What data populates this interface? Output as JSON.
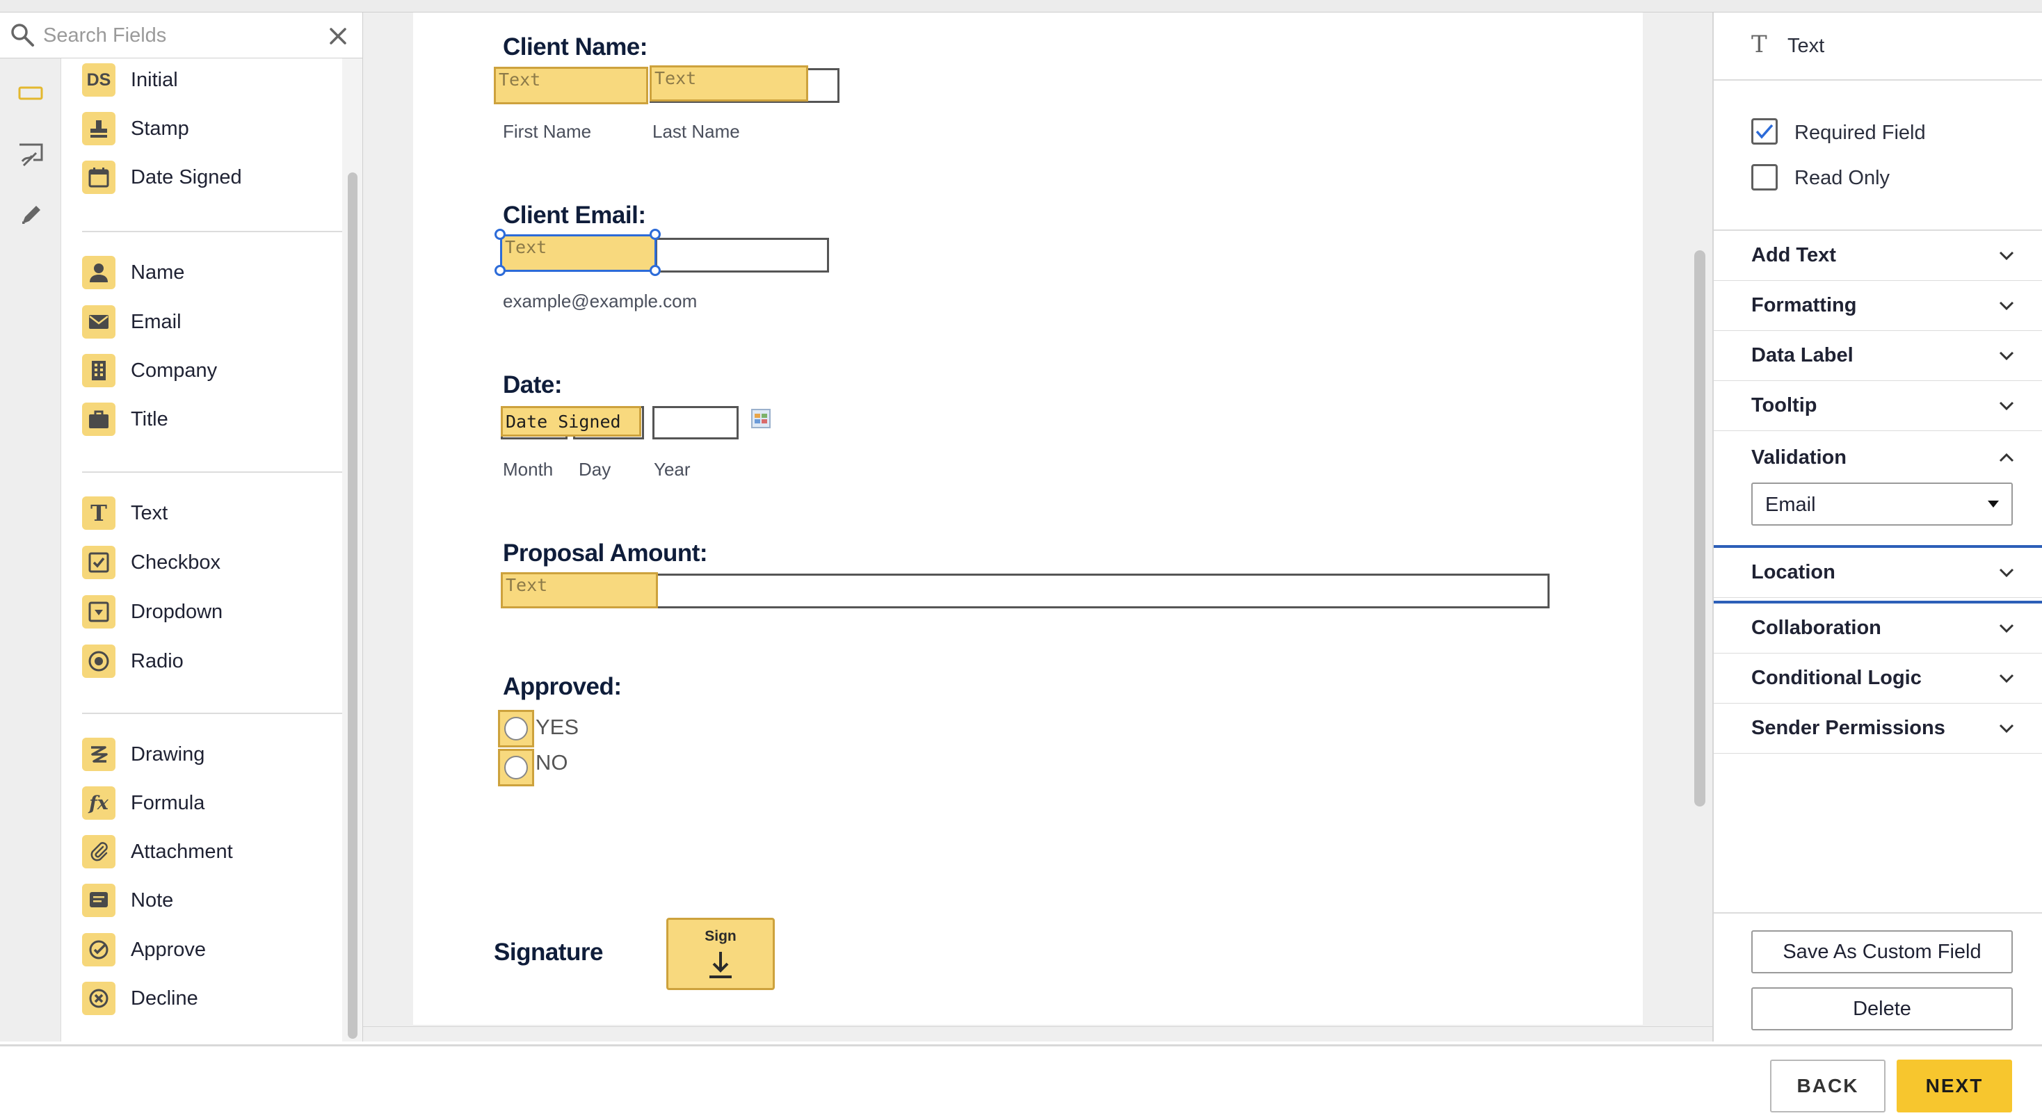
{
  "search": {
    "placeholder": "Search Fields"
  },
  "rail": {
    "items": [
      {
        "icon": "field-icon"
      },
      {
        "icon": "sign-edit-icon"
      },
      {
        "icon": "pencil-icon"
      }
    ]
  },
  "palette": {
    "group1": [
      {
        "label": "Initial",
        "icon": "initial-icon"
      },
      {
        "label": "Stamp",
        "icon": "stamp-icon"
      },
      {
        "label": "Date Signed",
        "icon": "calendar-icon"
      }
    ],
    "group2": [
      {
        "label": "Name",
        "icon": "person-icon"
      },
      {
        "label": "Email",
        "icon": "envelope-icon"
      },
      {
        "label": "Company",
        "icon": "building-icon"
      },
      {
        "label": "Title",
        "icon": "briefcase-icon"
      }
    ],
    "group3": [
      {
        "label": "Text",
        "icon": "text-icon"
      },
      {
        "label": "Checkbox",
        "icon": "checkbox-icon"
      },
      {
        "label": "Dropdown",
        "icon": "dropdown-icon"
      },
      {
        "label": "Radio",
        "icon": "radio-icon"
      }
    ],
    "group4": [
      {
        "label": "Drawing",
        "icon": "drawing-icon"
      },
      {
        "label": "Formula",
        "icon": "formula-icon"
      },
      {
        "label": "Attachment",
        "icon": "paperclip-icon"
      },
      {
        "label": "Note",
        "icon": "note-icon"
      },
      {
        "label": "Approve",
        "icon": "approve-icon"
      },
      {
        "label": "Decline",
        "icon": "decline-icon"
      }
    ],
    "initial_glyph": "DS"
  },
  "document": {
    "client_name": {
      "heading": "Client Name:",
      "tag1": "Text",
      "tag2": "Text",
      "first_label": "First Name",
      "last_label": "Last Name"
    },
    "client_email": {
      "heading": "Client Email:",
      "tag": "Text",
      "hint": "example@example.com"
    },
    "date": {
      "heading": "Date:",
      "tag": "Date Signed",
      "month": "Month",
      "day": "Day",
      "year": "Year"
    },
    "proposal": {
      "heading": "Proposal Amount:",
      "tag": "Text"
    },
    "approved": {
      "heading": "Approved:",
      "options": [
        "YES",
        "NO"
      ]
    },
    "signature": {
      "label": "Signature",
      "button": "Sign"
    }
  },
  "properties": {
    "field_type": "Text",
    "required_label": "Required Field",
    "required_checked": true,
    "readonly_label": "Read Only",
    "readonly_checked": false,
    "sections": [
      {
        "label": "Add Text",
        "expanded": false
      },
      {
        "label": "Formatting",
        "expanded": false
      },
      {
        "label": "Data Label",
        "expanded": false
      },
      {
        "label": "Tooltip",
        "expanded": false
      },
      {
        "label": "Validation",
        "expanded": true
      },
      {
        "label": "Location",
        "expanded": false
      },
      {
        "label": "Collaboration",
        "expanded": false
      },
      {
        "label": "Conditional Logic",
        "expanded": false
      },
      {
        "label": "Sender Permissions",
        "expanded": false
      }
    ],
    "validation_value": "Email",
    "save_custom": "Save As Custom Field",
    "delete": "Delete"
  },
  "footer": {
    "back": "BACK",
    "next": "NEXT"
  },
  "colors": {
    "accent": "#f7c62e",
    "tag_fill": "#f8d97e",
    "selection": "#2c6bd8",
    "heading": "#0f1d3a"
  }
}
